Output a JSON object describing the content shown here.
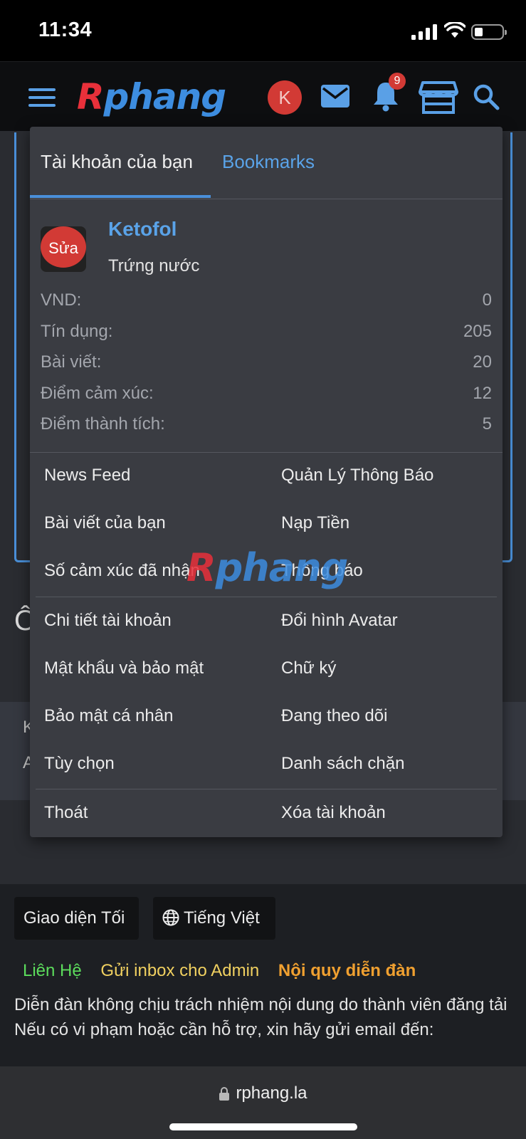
{
  "status_bar": {
    "time": "11:34"
  },
  "header": {
    "logo_r": "R",
    "logo_rest": "phang",
    "avatar_letter": "K",
    "notification_count": "9"
  },
  "background": {
    "heading_fragment": "Ô",
    "band_line1": "K",
    "band_line2": "A"
  },
  "menu": {
    "tabs": {
      "account": "Tài khoản của bạn",
      "bookmarks": "Bookmarks"
    },
    "user": {
      "avatar_edit": "Sửa",
      "name": "Ketofol",
      "title": "Trứng nước"
    },
    "stats": [
      {
        "label": "VND:",
        "value": "0"
      },
      {
        "label": "Tín dụng:",
        "value": "205"
      },
      {
        "label": "Bài viết:",
        "value": "20"
      },
      {
        "label": "Điểm cảm xúc:",
        "value": "12"
      },
      {
        "label": "Điểm thành tích:",
        "value": "5"
      }
    ],
    "group1": {
      "news_feed": "News Feed",
      "manage_notifications": "Quản Lý Thông Báo",
      "your_posts": "Bài viết của bạn",
      "deposit": "Nạp Tiền",
      "reactions_received": "Số cảm xúc đã nhận",
      "notifications": "Thông báo"
    },
    "group2": {
      "account_details": "Chi tiết tài khoản",
      "change_avatar": "Đổi hình Avatar",
      "password_security": "Mật khẩu và bảo mật",
      "signature": "Chữ ký",
      "privacy": "Bảo mật cá nhân",
      "following": "Đang theo dõi",
      "preferences": "Tùy chọn",
      "ignore_list": "Danh sách chặn"
    },
    "group3": {
      "logout": "Thoát",
      "delete_account": "Xóa tài khoản"
    }
  },
  "watermark": {
    "r": "R",
    "rest": "phang"
  },
  "footer": {
    "dark_style": "Giao diện Tối",
    "language": "Tiếng Việt",
    "links": {
      "contact": "Liên Hệ",
      "inbox_admin": "Gửi inbox cho Admin",
      "rules": "Nội quy diễn đàn"
    },
    "disclaimer_line1": "Diễn đàn không chịu trách nhiệm nội dung do thành viên đăng tải",
    "disclaimer_line2": "Nếu có vi phạm hoặc cần hỗ trợ, xin hãy gửi email đến:"
  },
  "browser": {
    "url": "rphang.la"
  },
  "colors": {
    "accent": "#4a90d9",
    "brand_red": "#e8303a",
    "contact": "#5cdc5c",
    "inbox": "#f0d060",
    "rules": "#f0a030"
  }
}
